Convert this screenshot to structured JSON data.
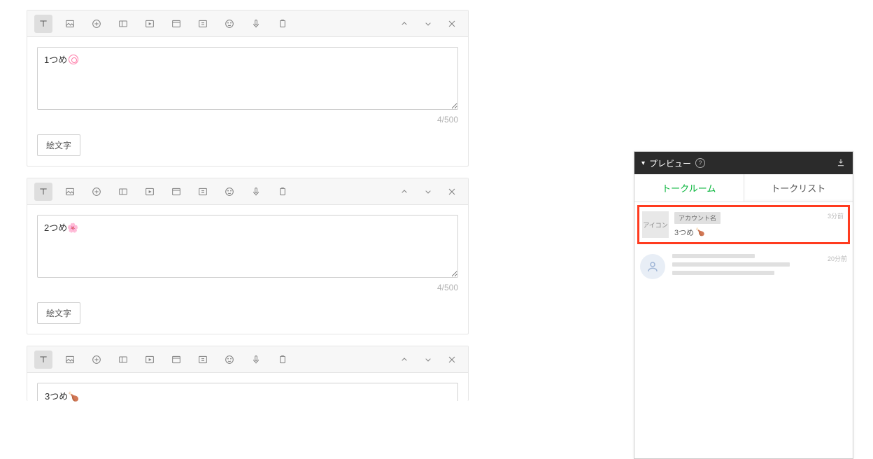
{
  "cards": [
    {
      "text": "1つめ",
      "emoji": "swirl",
      "count": "4/500",
      "emoji_btn": "絵文字"
    },
    {
      "text": "2つめ",
      "emoji": "petal",
      "count": "4/500",
      "emoji_btn": "絵文字"
    },
    {
      "text": "3つめ",
      "emoji": "drum",
      "count": "",
      "emoji_btn": ""
    }
  ],
  "toolbar_icons": [
    "text",
    "image",
    "plus-circle",
    "coupon",
    "play-box",
    "window",
    "video-box",
    "smiley",
    "mic",
    "clipboard"
  ],
  "toolbar_right": [
    "chevron-up",
    "chevron-down",
    "close"
  ],
  "preview": {
    "title": "プレビュー",
    "tabs": {
      "active": "トークルーム",
      "inactive": "トークリスト"
    },
    "highlight": {
      "avatar_label": "アイコン",
      "account_label": "アカウント名",
      "text": "3つめ",
      "time": "3分前"
    },
    "row2_time": "20分前"
  }
}
